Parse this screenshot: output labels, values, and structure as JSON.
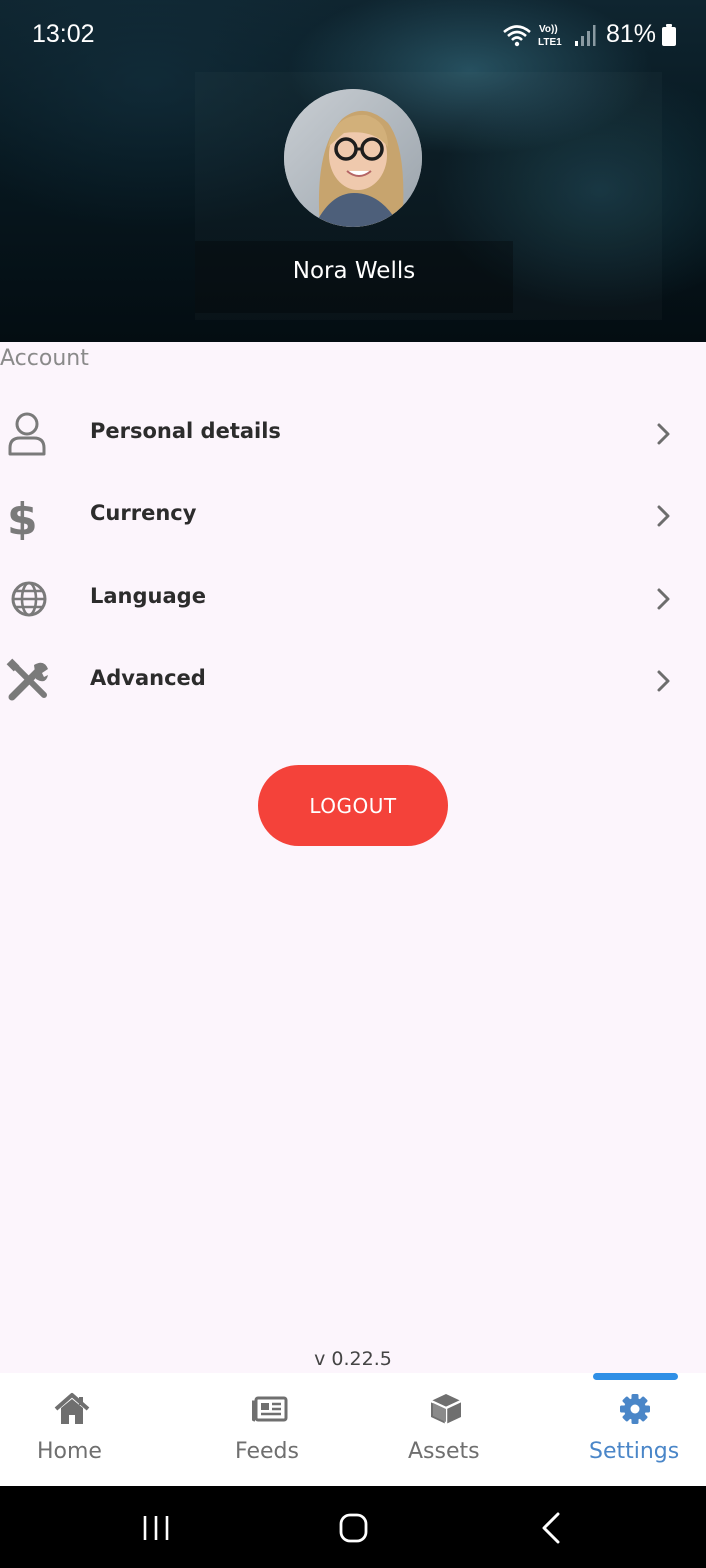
{
  "status_bar": {
    "time": "13:02",
    "network_label": "Vo)) LTE1",
    "battery": "81%",
    "icons": [
      "wifi-icon",
      "volte-icon",
      "signal-icon",
      "battery-icon"
    ]
  },
  "profile": {
    "name": "Nora Wells",
    "avatar_icon": "avatar-photo"
  },
  "account": {
    "section_title": "Account",
    "items": [
      {
        "label": "Personal details",
        "icon": "person-icon"
      },
      {
        "label": "Currency",
        "icon": "dollar-icon"
      },
      {
        "label": "Language",
        "icon": "globe-icon"
      },
      {
        "label": "Advanced",
        "icon": "tools-icon"
      }
    ]
  },
  "logout_label": "LOGOUT",
  "version": "v 0.22.5",
  "tabs": [
    {
      "label": "Home",
      "icon": "home-icon",
      "active": false
    },
    {
      "label": "Feeds",
      "icon": "newspaper-icon",
      "active": false
    },
    {
      "label": "Assets",
      "icon": "cube-icon",
      "active": false
    },
    {
      "label": "Settings",
      "icon": "gear-icon",
      "active": true
    }
  ],
  "colors": {
    "accent": "#4a86c8",
    "indicator": "#2f8fe6",
    "logout": "#f4423a",
    "background": "#fcf5fc",
    "icon_gray": "#6f6f6f"
  }
}
